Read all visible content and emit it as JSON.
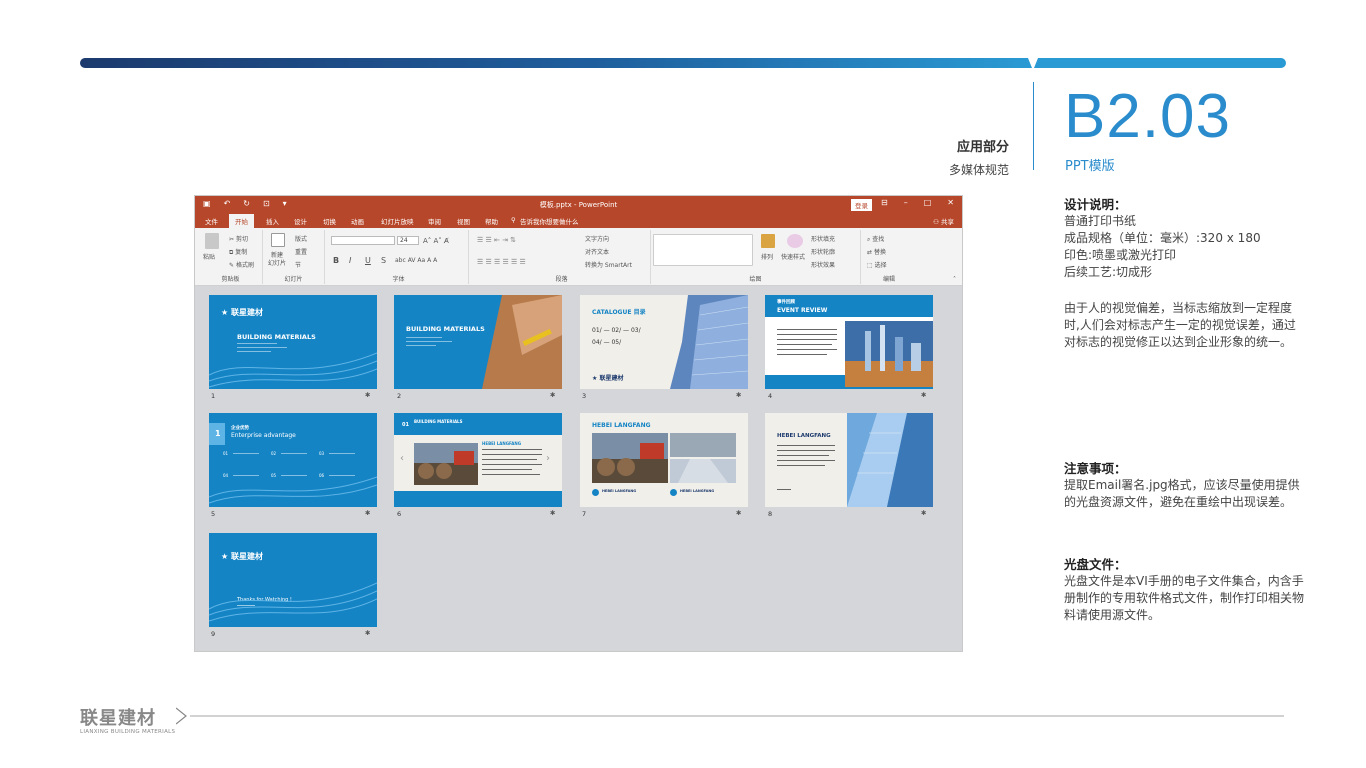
{
  "section": {
    "label": "应用部分",
    "sub": "多媒体规范"
  },
  "code": {
    "value": "B2.03",
    "sub": "PPT模版"
  },
  "colors": {
    "accent": "#2a8ccc",
    "dark_navy": "#1c3a6e",
    "ppt_red": "#b7472a",
    "slide_blue": "#1584c5"
  },
  "notes": {
    "design": {
      "heading": "设计说明：",
      "lines": [
        "普通打印书纸",
        "成品规格（单位：毫米）:320 x 180",
        "印色:喷墨或激光打印",
        "后续工艺:切成形"
      ]
    },
    "paragraph": "由于人的视觉偏差，当标志缩放到一定程度时,人们会对标志产生一定的视觉误差，通过对标志的视觉修正以达到企业形象的统一。",
    "caution": {
      "heading": "注意事项：",
      "text": "提取Email署名.jpg格式，应该尽量使用提供的光盘资源文件，避免在重绘中出现误差。"
    },
    "disc": {
      "heading": "光盘文件：",
      "text": "光盘文件是本VI手册的电子文件集合，内含手册制作的专用软件格式文件，制作打印相关物料请使用源文件。"
    }
  },
  "ppt": {
    "title": "模板.pptx - PowerPoint",
    "login": "登录",
    "share": "共享",
    "tell_me": "告诉我你想要做什么",
    "tabs": [
      "文件",
      "开始",
      "插入",
      "设计",
      "切换",
      "动画",
      "幻灯片放映",
      "审阅",
      "视图",
      "帮助"
    ],
    "active_tab": "开始",
    "ribbon": {
      "clipboard": {
        "label": "剪贴板",
        "paste": "粘贴",
        "cut": "剪切",
        "copy": "复制",
        "painter": "格式刷"
      },
      "slides": {
        "label": "幻灯片",
        "new": "新建",
        "new2": "幻灯片",
        "layout": "版式",
        "reset": "重置",
        "section": "节"
      },
      "font": {
        "label": "字体",
        "size": "24"
      },
      "paragraph": {
        "label": "段落",
        "dir": "文字方向",
        "align": "对齐文本",
        "smartart": "转换为 SmartArt"
      },
      "drawing": {
        "label": "绘图",
        "arrange": "排列",
        "quick": "快速样式",
        "fill": "形状填充",
        "outline": "形状轮廓",
        "effect": "形状效果"
      },
      "editing": {
        "label": "编辑",
        "find": "查找",
        "replace": "替换",
        "select": "选择"
      }
    },
    "slides": [
      {
        "num": "1",
        "title": "BUILDING MATERIALS",
        "logo": "联星建材"
      },
      {
        "num": "2",
        "title": "BUILDING MATERIALS"
      },
      {
        "num": "3",
        "title": "CATALOGUE",
        "title_cn": "目录",
        "items": [
          "01",
          "02",
          "03",
          "04",
          "05"
        ],
        "logo": "联星建材"
      },
      {
        "num": "4",
        "title_cn": "事件回顾",
        "title": "EVENT REVIEW"
      },
      {
        "num": "5",
        "index": "1",
        "title_cn": "企业优势",
        "title": "Enterprise advantage",
        "items": [
          "01",
          "02",
          "03",
          "04",
          "05",
          "06"
        ]
      },
      {
        "num": "6",
        "index": "01",
        "title": "BUILDING MATERIALS",
        "heading": "HEBEI LANGFANG"
      },
      {
        "num": "7",
        "title": "HEBEI LANGFANG",
        "captions": [
          "HEBEI LANGFANG",
          "HEBEI LANGFANG"
        ]
      },
      {
        "num": "8",
        "title": "HEBEI LANGFANG"
      },
      {
        "num": "9",
        "logo": "联星建材",
        "title": "Thanks for Watching !"
      }
    ]
  },
  "footer": {
    "logo_cn": "联星建材",
    "logo_en": "LIANXING BUILDING MATERIALS"
  }
}
